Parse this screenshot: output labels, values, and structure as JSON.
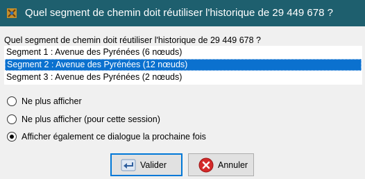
{
  "window": {
    "title": "Quel segment de chemin doit réutiliser l'historique de 29 449 678 ?"
  },
  "dialog": {
    "question": "Quel segment de chemin doit réutiliser l'historique de 29 449 678 ?",
    "segments": [
      {
        "label": "Segment 1 : Avenue des Pyrénées (6 nœuds)",
        "selected": false
      },
      {
        "label": "Segment 2 : Avenue des Pyrénées (12 nœuds)",
        "selected": true
      },
      {
        "label": "Segment 3 : Avenue des Pyrénées (2 nœuds)",
        "selected": false
      }
    ],
    "options": [
      {
        "label": "Ne plus afficher",
        "checked": false
      },
      {
        "label": "Ne plus afficher (pour cette session)",
        "checked": false
      },
      {
        "label": "Afficher également ce dialogue la prochaine fois",
        "checked": true
      }
    ],
    "buttons": {
      "ok_label": "Valider",
      "cancel_label": "Annuler"
    }
  },
  "colors": {
    "titlebar": "#1e5f6e",
    "selection": "#0b71cf",
    "default_button_border": "#0078d7"
  },
  "icons": [
    "josm-app-icon",
    "validate-arrow-icon",
    "cancel-x-icon"
  ]
}
